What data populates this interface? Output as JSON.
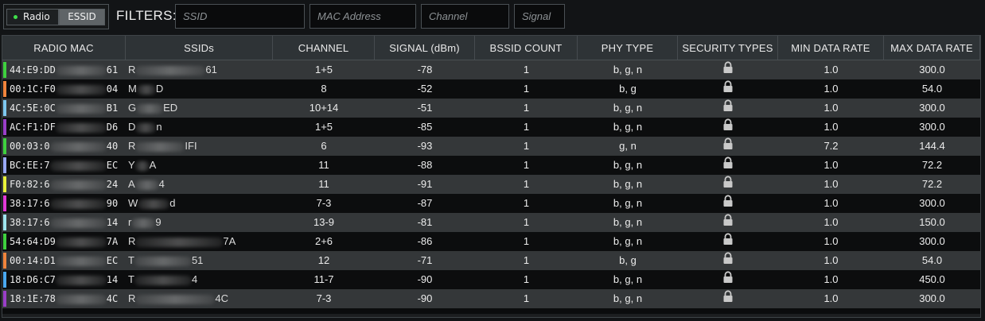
{
  "modes": {
    "radio_label": "Radio",
    "essid_label": "ESSID",
    "radio_indicator_color": "#3fe04a"
  },
  "filters": {
    "label": "FILTERS:",
    "ssid_placeholder": "SSID",
    "mac_placeholder": "MAC Address",
    "channel_placeholder": "Channel",
    "signal_placeholder": "Signal"
  },
  "table": {
    "columns": [
      "RADIO MAC",
      "SSIDs",
      "CHANNEL",
      "SIGNAL (dBm)",
      "BSSID COUNT",
      "PHY TYPE",
      "SECURITY TYPES",
      "MIN DATA RATE",
      "MAX DATA RATE"
    ],
    "rows": [
      {
        "mac_start": "44:E9:DD",
        "mac_end": "61",
        "color": "#3fd03f",
        "ssid_start": "R",
        "ssid_end": "61",
        "channel": "1+5",
        "signal": "-78",
        "bssid": "1",
        "phy": "b, g, n",
        "security": "lock-icon",
        "min_rate": "1.0",
        "max_rate": "300.0"
      },
      {
        "mac_start": "00:1C:F0",
        "mac_end": "04",
        "color": "#f0843c",
        "ssid_start": "M",
        "ssid_end": "D",
        "channel": "8",
        "signal": "-52",
        "bssid": "1",
        "phy": "b, g",
        "security": "lock-icon",
        "min_rate": "1.0",
        "max_rate": "54.0"
      },
      {
        "mac_start": "4C:5E:0C",
        "mac_end": "B1",
        "color": "#7ec8f0",
        "ssid_start": "G",
        "ssid_end": "ED",
        "channel": "10+14",
        "signal": "-51",
        "bssid": "1",
        "phy": "b, g, n",
        "security": "lock-icon",
        "min_rate": "1.0",
        "max_rate": "300.0"
      },
      {
        "mac_start": "AC:F1:DF",
        "mac_end": "D6",
        "color": "#9a3fc8",
        "ssid_start": "D",
        "ssid_end": "n",
        "channel": "1+5",
        "signal": "-85",
        "bssid": "1",
        "phy": "b, g, n",
        "security": "lock-icon",
        "min_rate": "1.0",
        "max_rate": "300.0"
      },
      {
        "mac_start": "00:03:0",
        "mac_end": "40",
        "color": "#3fd03f",
        "ssid_start": "R",
        "ssid_end": "IFI",
        "channel": "6",
        "signal": "-93",
        "bssid": "1",
        "phy": "g, n",
        "security": "lock-icon",
        "min_rate": "7.2",
        "max_rate": "144.4"
      },
      {
        "mac_start": "BC:EE:7",
        "mac_end": "EC",
        "color": "#9aa9f8",
        "ssid_start": "Y",
        "ssid_end": "A",
        "channel": "11",
        "signal": "-88",
        "bssid": "1",
        "phy": "b, g, n",
        "security": "lock-icon",
        "min_rate": "1.0",
        "max_rate": "72.2"
      },
      {
        "mac_start": "F0:82:6",
        "mac_end": "24",
        "color": "#e8f23a",
        "ssid_start": "A",
        "ssid_end": "4",
        "channel": "11",
        "signal": "-91",
        "bssid": "1",
        "phy": "b, g, n",
        "security": "lock-icon",
        "min_rate": "1.0",
        "max_rate": "72.2"
      },
      {
        "mac_start": "38:17:6",
        "mac_end": "90",
        "color": "#e23ad8",
        "ssid_start": "W",
        "ssid_end": "d",
        "channel": "7-3",
        "signal": "-87",
        "bssid": "1",
        "phy": "b, g, n",
        "security": "lock-icon",
        "min_rate": "1.0",
        "max_rate": "300.0"
      },
      {
        "mac_start": "38:17:6",
        "mac_end": "14",
        "color": "#9fe6f0",
        "ssid_start": "r",
        "ssid_end": "9",
        "channel": "13-9",
        "signal": "-81",
        "bssid": "1",
        "phy": "b, g, n",
        "security": "lock-icon",
        "min_rate": "1.0",
        "max_rate": "150.0"
      },
      {
        "mac_start": "54:64:D9",
        "mac_end": "7A",
        "color": "#3fd03f",
        "ssid_start": "R",
        "ssid_end": "7A",
        "channel": "2+6",
        "signal": "-86",
        "bssid": "1",
        "phy": "b, g, n",
        "security": "lock-icon",
        "min_rate": "1.0",
        "max_rate": "300.0"
      },
      {
        "mac_start": "00:14:D1",
        "mac_end": "EC",
        "color": "#f0843c",
        "ssid_start": "T",
        "ssid_end": "51",
        "channel": "12",
        "signal": "-71",
        "bssid": "1",
        "phy": "b, g",
        "security": "lock-icon",
        "min_rate": "1.0",
        "max_rate": "54.0"
      },
      {
        "mac_start": "18:D6:C7",
        "mac_end": "14",
        "color": "#4aa8f0",
        "ssid_start": "T",
        "ssid_end": "4",
        "channel": "11-7",
        "signal": "-90",
        "bssid": "1",
        "phy": "b, g, n",
        "security": "lock-icon",
        "min_rate": "1.0",
        "max_rate": "450.0"
      },
      {
        "mac_start": "18:1E:78",
        "mac_end": "4C",
        "color": "#9a3fc8",
        "ssid_start": "R",
        "ssid_end": "4C",
        "channel": "7-3",
        "signal": "-90",
        "bssid": "1",
        "phy": "b, g, n",
        "security": "lock-icon",
        "min_rate": "1.0",
        "max_rate": "300.0"
      }
    ]
  }
}
